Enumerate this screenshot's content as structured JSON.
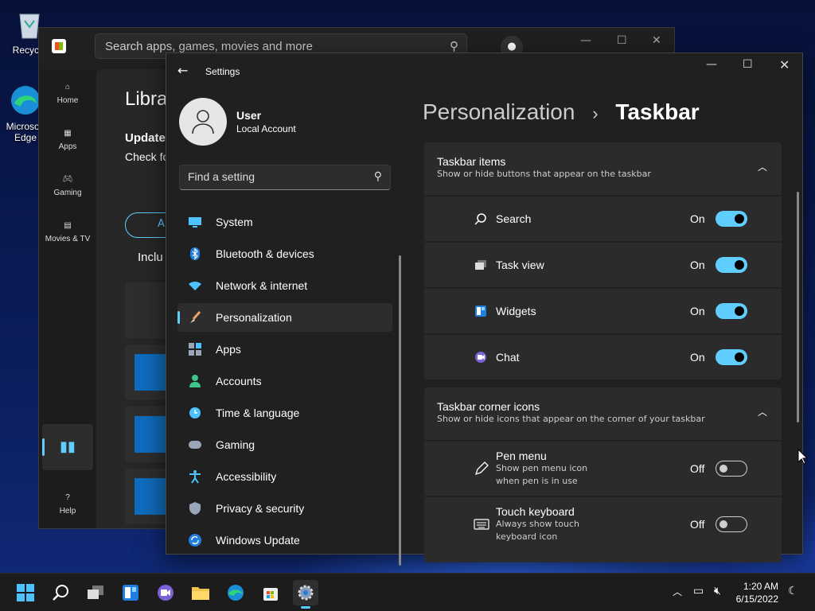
{
  "desktop": {
    "recycle": "Recycle",
    "edge": "Microsoft Edge"
  },
  "store": {
    "search_placeholder": "Search apps, games, movies and more",
    "nav": [
      {
        "label": "Home"
      },
      {
        "label": "Apps"
      },
      {
        "label": "Gaming"
      },
      {
        "label": "Movies & TV"
      }
    ],
    "help": "Help",
    "library_title": "Libra",
    "updates": "Update",
    "check": "Check fo",
    "included": "Inclu",
    "pill": "A"
  },
  "settings": {
    "title": "Settings",
    "user_name": "User",
    "account_type": "Local Account",
    "find_placeholder": "Find a setting",
    "nav": [
      {
        "label": "System",
        "icon": "monitor-icon"
      },
      {
        "label": "Bluetooth & devices",
        "icon": "bluetooth-icon"
      },
      {
        "label": "Network & internet",
        "icon": "wifi-icon"
      },
      {
        "label": "Personalization",
        "icon": "brush-icon",
        "selected": true
      },
      {
        "label": "Apps",
        "icon": "apps-icon"
      },
      {
        "label": "Accounts",
        "icon": "person-icon"
      },
      {
        "label": "Time & language",
        "icon": "clock-globe-icon"
      },
      {
        "label": "Gaming",
        "icon": "gamepad-icon"
      },
      {
        "label": "Accessibility",
        "icon": "accessibility-icon"
      },
      {
        "label": "Privacy & security",
        "icon": "shield-icon"
      },
      {
        "label": "Windows Update",
        "icon": "update-icon"
      }
    ],
    "breadcrumb_parent": "Personalization",
    "breadcrumb_sep": "›",
    "breadcrumb_current": "Taskbar",
    "taskbar_items": {
      "title": "Taskbar items",
      "subtitle": "Show or hide buttons that appear on the taskbar",
      "rows": [
        {
          "label": "Search",
          "state": "On"
        },
        {
          "label": "Task view",
          "state": "On"
        },
        {
          "label": "Widgets",
          "state": "On"
        },
        {
          "label": "Chat",
          "state": "On"
        }
      ]
    },
    "corner_icons": {
      "title": "Taskbar corner icons",
      "subtitle": "Show or hide icons that appear on the corner of your taskbar",
      "rows": [
        {
          "label": "Pen menu",
          "desc1": "Show pen menu icon",
          "desc2": "when pen is in use",
          "state": "Off"
        },
        {
          "label": "Touch keyboard",
          "desc1": "Always show touch",
          "desc2": "keyboard icon",
          "state": "Off"
        }
      ]
    }
  },
  "taskbar": {
    "time": "1:20 AM",
    "date": "6/15/2022"
  },
  "colors": {
    "accent": "#60cdff",
    "panel": "#2b2b2b",
    "window": "#202020"
  }
}
